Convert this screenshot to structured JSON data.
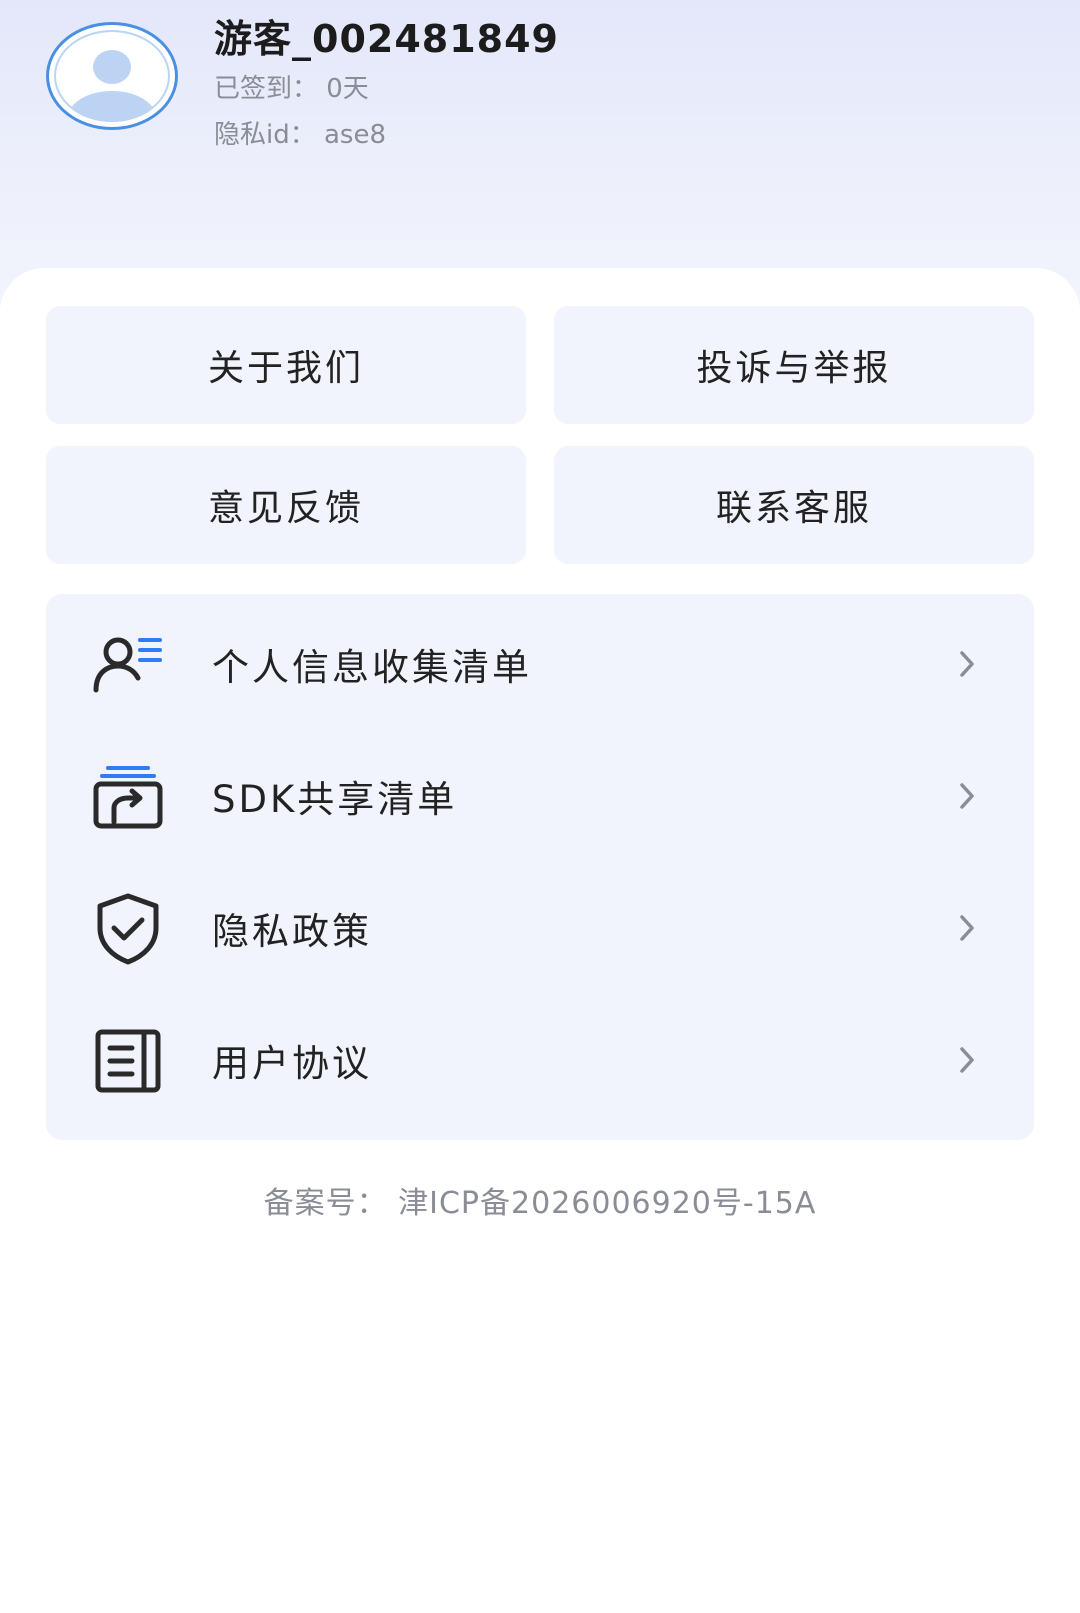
{
  "profile": {
    "username": "游客_002481849",
    "checkin": "已签到： 0天",
    "privacy_id": "隐私id： ase8"
  },
  "grid": {
    "about_us": "关于我们",
    "complaint": "投诉与举报",
    "feedback": "意见反馈",
    "customer_service": "联系客服"
  },
  "menu": {
    "items": [
      {
        "label": "个人信息收集清单",
        "icon": "person-list-icon"
      },
      {
        "label": "SDK共享清单",
        "icon": "sdk-share-icon"
      },
      {
        "label": "隐私政策",
        "icon": "shield-check-icon"
      },
      {
        "label": "用户协议",
        "icon": "document-icon"
      }
    ]
  },
  "footer": {
    "icp": "备案号： 津ICP备2026006920号-15A"
  },
  "colors": {
    "header_gradient_top": "#e3e7fa",
    "panel_bg": "#f2f4fd",
    "accent_blue": "#4a90e2",
    "muted_text": "#8a8d96"
  }
}
